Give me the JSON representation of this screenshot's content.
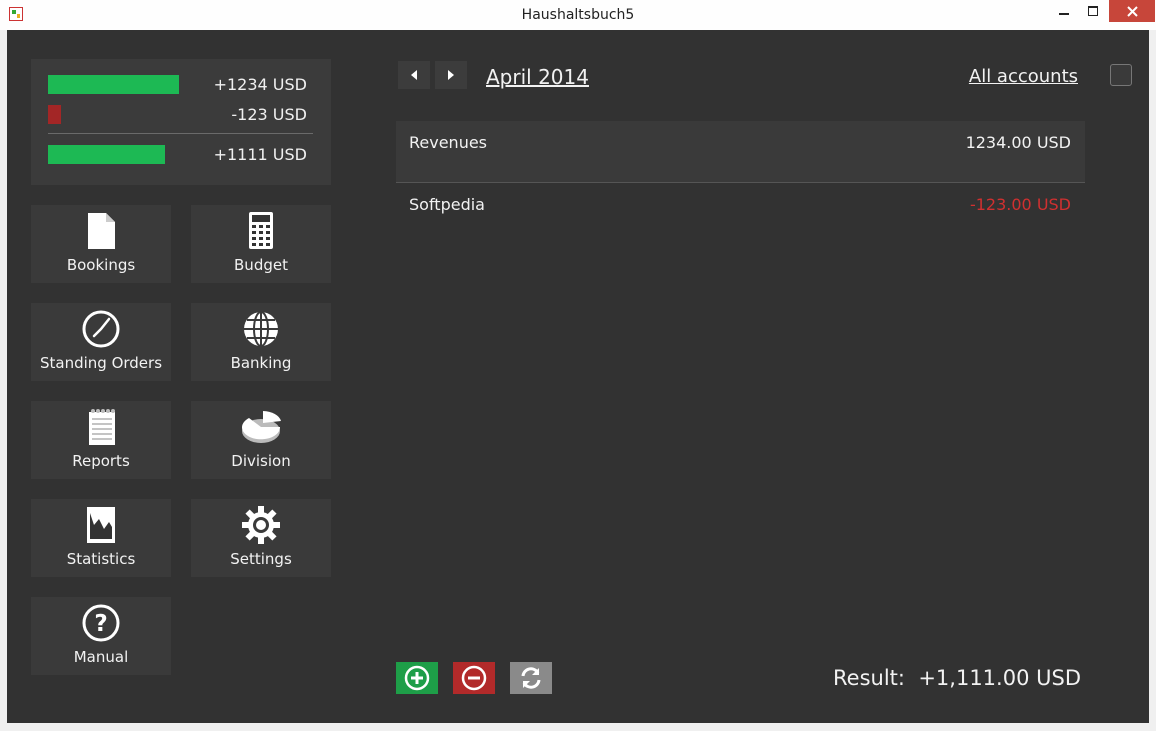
{
  "window": {
    "title": "Haushaltsbuch5"
  },
  "summary": {
    "revenue": {
      "text": "+1234 USD",
      "fraction": 0.73
    },
    "expense": {
      "text": "-123 USD",
      "fraction": 0.07
    },
    "total": {
      "text": "+1111 USD",
      "fraction": 0.65
    }
  },
  "tiles": [
    {
      "label": "Bookings",
      "icon": "document-icon"
    },
    {
      "label": "Budget",
      "icon": "calculator-icon"
    },
    {
      "label": "Standing Orders",
      "icon": "clock-icon"
    },
    {
      "label": "Banking",
      "icon": "globe-icon"
    },
    {
      "label": "Reports",
      "icon": "notepad-icon"
    },
    {
      "label": "Division",
      "icon": "pie-chart-icon"
    },
    {
      "label": "Statistics",
      "icon": "picture-icon"
    },
    {
      "label": "Settings",
      "icon": "gear-icon"
    },
    {
      "label": "Manual",
      "icon": "question-icon"
    }
  ],
  "header": {
    "month": "April 2014",
    "accounts": "All accounts"
  },
  "entries": [
    {
      "name": "Revenues",
      "value": "1234.00 USD",
      "color": "#f2f2f2"
    },
    {
      "name": "Softpedia",
      "value": "-123.00 USD",
      "color": "#d03030"
    }
  ],
  "footer": {
    "result_label": "Result:",
    "result_value": "+1,111.00 USD"
  },
  "colors": {
    "positive": "#1db954",
    "negative": "#a32626",
    "background": "#323232",
    "tile": "#3a3a3a"
  }
}
